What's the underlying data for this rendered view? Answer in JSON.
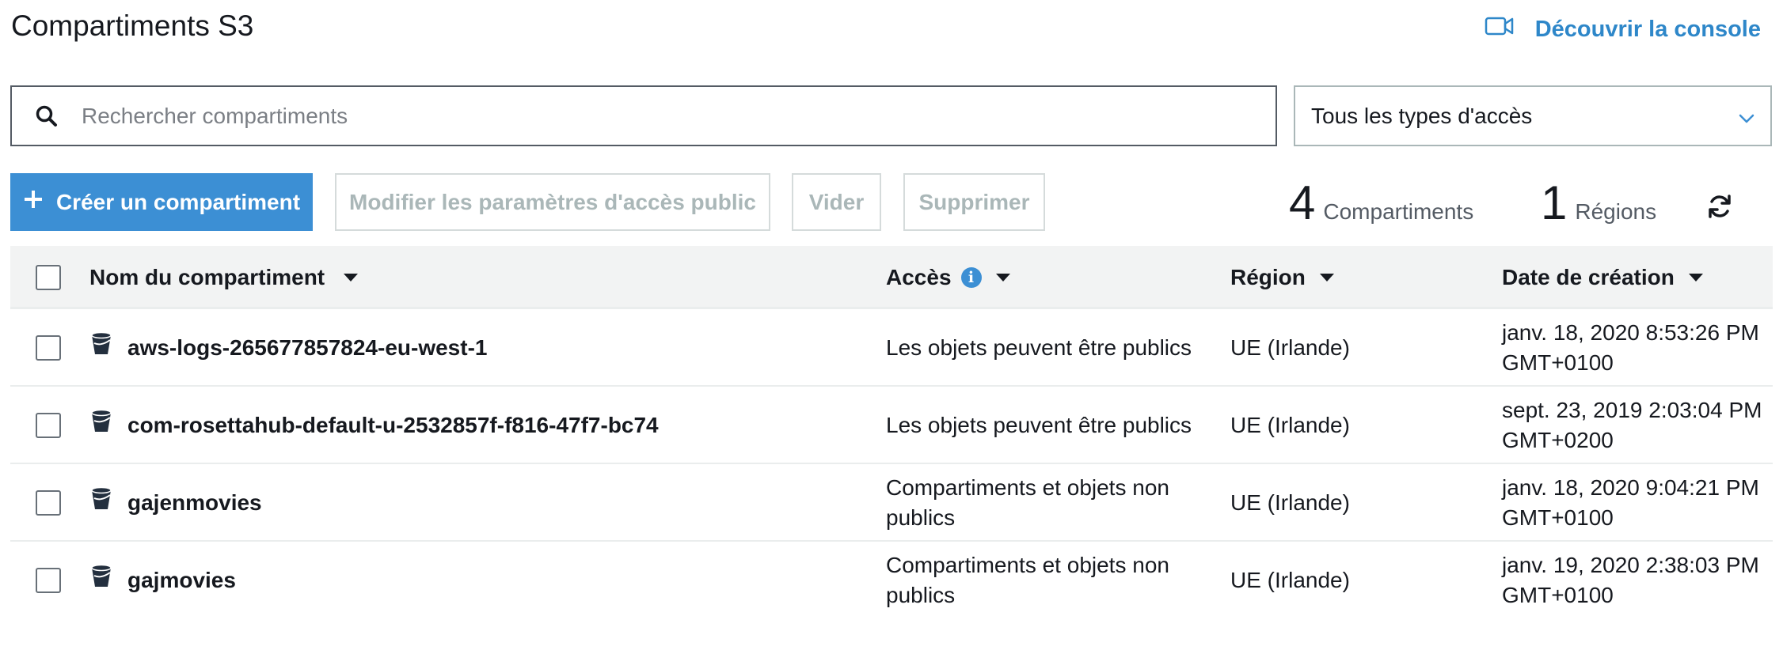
{
  "header": {
    "title": "Compartiments S3",
    "discover_label": "Découvrir la console"
  },
  "search": {
    "placeholder": "Rechercher compartiments",
    "value": ""
  },
  "access_filter": {
    "selected": "Tous les types d'accès"
  },
  "toolbar": {
    "create_label": "Créer un compartiment",
    "modify_label": "Modifier les paramètres d'accès public",
    "empty_label": "Vider",
    "delete_label": "Supprimer"
  },
  "stats": {
    "buckets_count": "4",
    "buckets_label": "Compartiments",
    "regions_count": "1",
    "regions_label": "Régions"
  },
  "table": {
    "columns": {
      "name": "Nom du compartiment",
      "access": "Accès",
      "region": "Région",
      "created": "Date de création"
    },
    "rows": [
      {
        "name": "aws-logs-265677857824-eu-west-1",
        "access": "Les objets peuvent être publics",
        "region": "UE (Irlande)",
        "created": "janv. 18, 2020 8:53:26 PM GMT+0100"
      },
      {
        "name": "com-rosettahub-default-u-2532857f-f816-47f7-bc74",
        "access": "Les objets peuvent être publics",
        "region": "UE (Irlande)",
        "created": "sept. 23, 2019 2:03:04 PM GMT+0200"
      },
      {
        "name": "gajenmovies",
        "access": "Compartiments et objets non publics",
        "region": "UE (Irlande)",
        "created": "janv. 18, 2020 9:04:21 PM GMT+0100"
      },
      {
        "name": "gajmovies",
        "access": "Compartiments et objets non publics",
        "region": "UE (Irlande)",
        "created": "janv. 19, 2020 2:38:03 PM GMT+0100"
      }
    ]
  },
  "colors": {
    "accent": "#3c8fd4",
    "link": "#2e87c9",
    "header_bg": "#f2f3f3"
  }
}
